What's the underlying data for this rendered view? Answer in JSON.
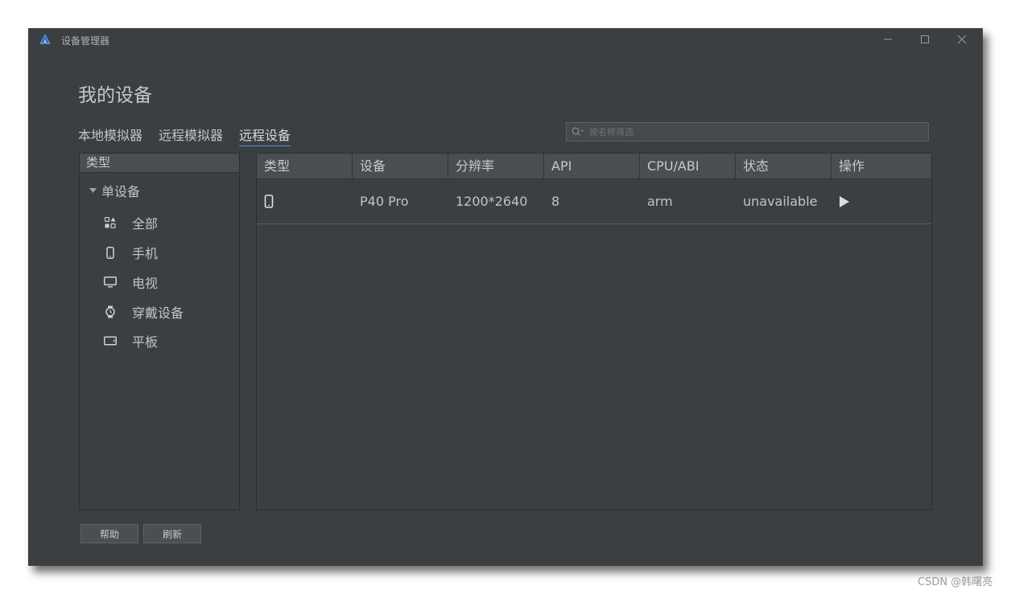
{
  "window": {
    "title": "设备管理器"
  },
  "page": {
    "title": "我的设备"
  },
  "tabs": [
    {
      "label": "本地模拟器",
      "active": false
    },
    {
      "label": "远程模拟器",
      "active": false
    },
    {
      "label": "远程设备",
      "active": true
    }
  ],
  "search": {
    "placeholder": "按名称筛选",
    "value": ""
  },
  "sidebar": {
    "header": "类型",
    "group": "单设备",
    "items": [
      {
        "label": "全部",
        "icon": "grid-icon"
      },
      {
        "label": "手机",
        "icon": "phone-icon"
      },
      {
        "label": "电视",
        "icon": "tv-icon"
      },
      {
        "label": "穿戴设备",
        "icon": "watch-icon"
      },
      {
        "label": "平板",
        "icon": "tablet-icon"
      }
    ]
  },
  "table": {
    "columns": [
      "类型",
      "设备",
      "分辨率",
      "API",
      "CPU/ABI",
      "状态",
      "操作"
    ],
    "rows": [
      {
        "type_icon": "phone-icon",
        "device": "P40 Pro",
        "resolution": "1200*2640",
        "api": "8",
        "cpu": "arm",
        "status": "unavailable",
        "action_icon": "play-icon"
      }
    ]
  },
  "buttons": {
    "help": "帮助",
    "refresh": "刷新"
  },
  "watermark": "CSDN @韩曙亮",
  "colors": {
    "background": "#3c3f41",
    "header": "#4a4e50",
    "accent": "#5a8fd6"
  }
}
